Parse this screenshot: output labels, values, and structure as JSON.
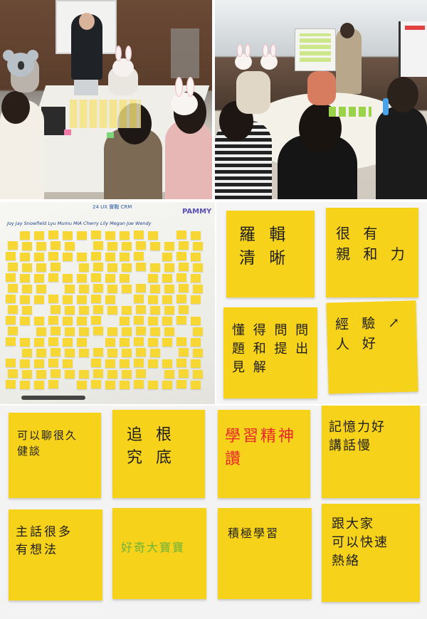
{
  "board_header": {
    "top_text": "24 UX 實戰 CRM",
    "names": "Joy  Jay  Snowfield  Lyu  Mumu  MIA  Cherry  Lily  Megan  Joe  Wendy",
    "corner_name": "PAMMY"
  },
  "notes_top": [
    {
      "text": "羅 輯\n清 晰"
    },
    {
      "text": "很 有\n親 和 力"
    },
    {
      "text": "懂 得 問 問\n題 和 提 出\n見 解"
    },
    {
      "text": "經 驗 ↗\n人 好"
    }
  ],
  "notes_bottom": [
    {
      "text": "可以聊很久\n健談"
    },
    {
      "text": "追 根\n究 底"
    },
    {
      "text": "學習精神\n讚",
      "color": "#e8262c"
    },
    {
      "text": "記憶力好\n講話慢"
    },
    {
      "text": "主話很多\n有想法"
    },
    {
      "text": "好奇大寶寶",
      "color": "#6fb33a"
    },
    {
      "text": "積極學習"
    },
    {
      "text": "跟大家\n可以快速\n熱絡"
    }
  ],
  "colors": {
    "note": "#f7d21a",
    "ink": "#1d1d1d",
    "red": "#e8262c",
    "green": "#6fb33a"
  }
}
